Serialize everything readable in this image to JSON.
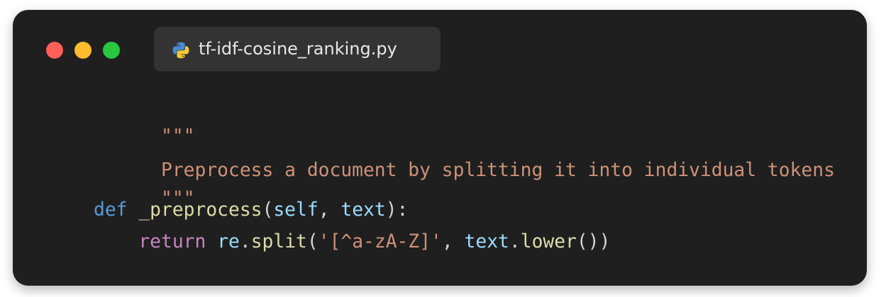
{
  "window": {
    "controls": {
      "close": {
        "icon": "close-dot-icon",
        "color": "#ff5f57"
      },
      "minimize": {
        "icon": "minimize-dot-icon",
        "color": "#febc2e"
      },
      "maximize": {
        "icon": "maximize-dot-icon",
        "color": "#28c840"
      }
    },
    "tab": {
      "icon": "python-icon",
      "filename": "tf-idf-cosine_ranking.py"
    }
  },
  "code": {
    "docstring_open": "\"\"\"",
    "docstring_text": "Preprocess a document by splitting it into individual tokens",
    "docstring_close": "\"\"\"",
    "def_keyword": "def",
    "function_name": "_preprocess",
    "paren_open": "(",
    "param_self": "self",
    "comma": ", ",
    "param_text": "text",
    "def_end": "):",
    "indent": "    ",
    "return_keyword": "return",
    "module": "re",
    "dot": ".",
    "split_fn": "split",
    "call_open": "(",
    "regex_string": "'[^a-zA-Z]'",
    "arg_comma": ", ",
    "text_var": "text",
    "dot2": ".",
    "lower_fn": "lower",
    "call_close": "())"
  },
  "colors": {
    "background": "#1f1f1f",
    "tab_background": "#333333",
    "docstring": "#ce9178",
    "keyword": "#569cd6",
    "control_keyword": "#c586c0",
    "function": "#dcdcaa",
    "variable": "#9cdcfe",
    "punctuation": "#d4d4d4"
  }
}
